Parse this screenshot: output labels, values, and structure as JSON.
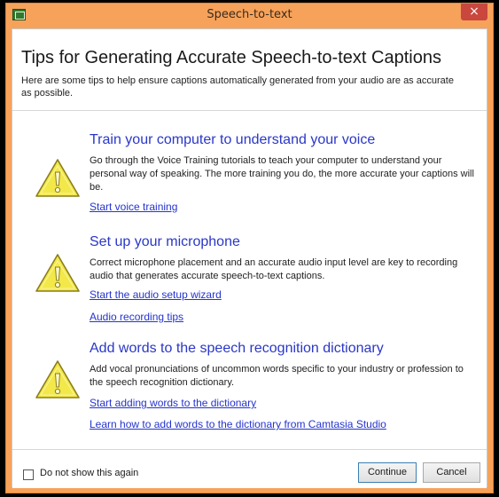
{
  "window": {
    "title": "Speech-to-text",
    "close_symbol": "×",
    "app_icon": "speech-app-icon"
  },
  "header": {
    "heading": "Tips for Generating Accurate Speech-to-text Captions",
    "subheading": "Here are some tips to help ensure captions automatically generated from your audio are as accurate as possible."
  },
  "sections": [
    {
      "icon": "warning-icon",
      "title": "Train your computer to understand your voice",
      "body": "Go through the Voice Training tutorials to teach your computer to understand your personal way of speaking. The more training you do, the more accurate your captions will be.",
      "links": [
        "Start voice training"
      ]
    },
    {
      "icon": "warning-icon",
      "title": "Set up your microphone",
      "body": "Correct microphone placement and an accurate audio input level are key to recording audio that generates accurate speech-to-text captions.",
      "links": [
        "Start the audio setup wizard",
        "Audio recording tips"
      ]
    },
    {
      "icon": "warning-icon",
      "title": "Add words to the speech recognition dictionary",
      "body": "Add vocal pronunciations of uncommon words specific to your industry or profession to the speech recognition dictionary.",
      "links": [
        "Start adding words to the dictionary",
        "Learn how to add words to the dictionary from Camtasia Studio"
      ]
    }
  ],
  "footer": {
    "checkbox_label": "Do not show this again",
    "checkbox_checked": false,
    "continue_label": "Continue",
    "cancel_label": "Cancel"
  },
  "colors": {
    "titlebar": "#f6a25a",
    "link": "#2433cf",
    "section_title": "#2a37c7",
    "warning_fill": "#f2e84a"
  }
}
